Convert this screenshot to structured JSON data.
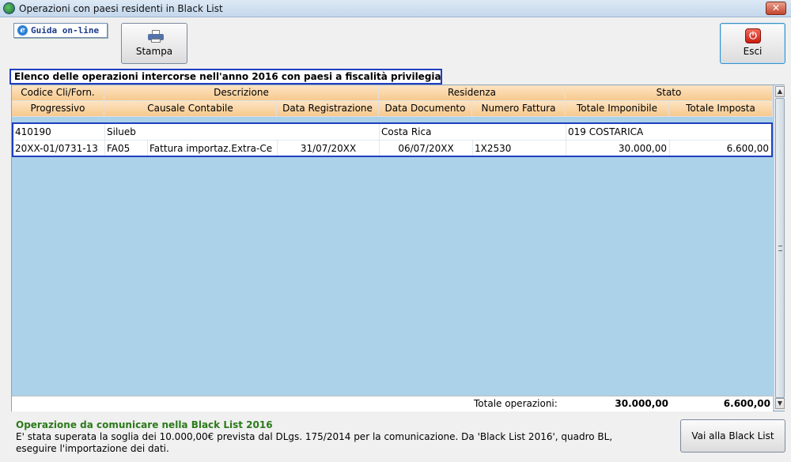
{
  "window": {
    "title": "Operazioni con paesi residenti in Black List",
    "close_label": "✕"
  },
  "toolbar": {
    "guida_label": "Guida on-line",
    "stampa_label": "Stampa",
    "esci_label": "Esci",
    "esci_icon": "power-icon",
    "stampa_icon": "printer-icon"
  },
  "heading": "Elenco delle operazioni intercorse nell'anno 2016 con paesi a fiscalità privilegiata",
  "grid": {
    "header_row1": [
      "Codice Cli/Forn.",
      "Descrizione",
      "Residenza",
      "Stato"
    ],
    "header_row2": [
      "Progressivo",
      "Causale Contabile",
      "Data Registrazione",
      "Data Documento",
      "Numero Fattura",
      "Totale Imponibile",
      "Totale Imposta"
    ],
    "record": {
      "codice": "410190",
      "descrizione": "Silueb",
      "residenza": "Costa Rica",
      "stato": "019 COSTARICA",
      "progressivo": "20XX-01/0731-13",
      "causale_codice": "FA05",
      "causale_descrizione": "Fattura importaz.Extra-Ce",
      "data_registrazione": "31/07/20XX",
      "data_documento": "06/07/20XX",
      "numero_fattura": "1X2530",
      "totale_imponibile": "30.000,00",
      "totale_imposta": "6.600,00"
    },
    "totals": {
      "label": "Totale operazioni:",
      "imponibile": "30.000,00",
      "imposta": "6.600,00"
    }
  },
  "note": {
    "title": "Operazione da comunicare nella Black List 2016",
    "text": "E' stata superata la soglia dei 10.000,00€ prevista dal DLgs. 175/2014 per la comunicazione. Da 'Black List 2016', quadro BL, eseguire l'importazione dei dati."
  },
  "blacklist_button": "Vai alla Black List",
  "colors": {
    "grid_background": "#acd2ea",
    "header_background": "#f7c98e",
    "highlight_border": "#1f3fbf",
    "note_title": "#2b7a1a"
  }
}
